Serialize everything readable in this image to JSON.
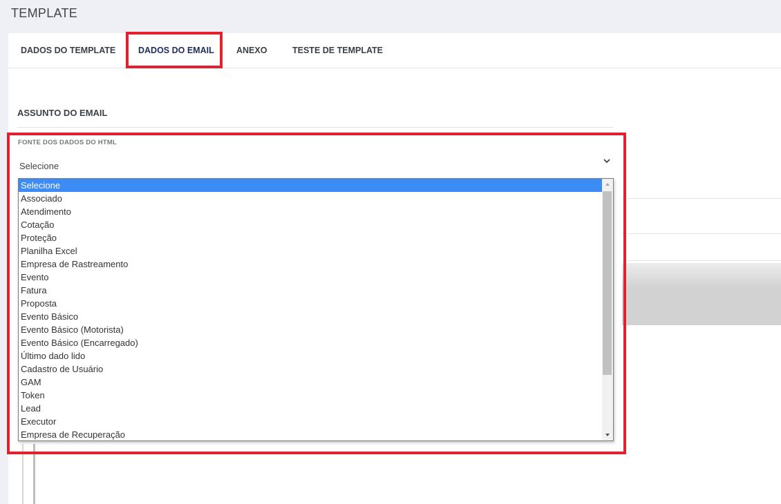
{
  "page": {
    "title": "TEMPLATE"
  },
  "tabs": [
    {
      "label": "DADOS DO TEMPLATE",
      "active": false
    },
    {
      "label": "DADOS DO EMAIL",
      "active": true
    },
    {
      "label": "ANEXO",
      "active": false
    },
    {
      "label": "TESTE DE TEMPLATE",
      "active": false
    }
  ],
  "section": {
    "title": "ASSUNTO DO EMAIL"
  },
  "field": {
    "label": "FONTE DOS DADOS DO HTML",
    "value": "Selecione",
    "options": [
      "Selecione",
      "Associado",
      "Atendimento",
      "Cotação",
      "Proteção",
      "Planilha Excel",
      "Empresa de Rastreamento",
      "Evento",
      "Fatura",
      "Proposta",
      "Evento Básico",
      "Evento Básico (Motorista)",
      "Evento Básico (Encarregado)",
      "Último dado lido",
      "Cadastro de Usuário",
      "GAM",
      "Token",
      "Lead",
      "Executor",
      "Empresa de Recuperação"
    ],
    "selected_index": 0
  },
  "colors": {
    "highlight": "#e3202d",
    "active_tab": "#1d2e5a",
    "selected_option": "#3d8bf5"
  },
  "icons": {
    "select_arrow": "chevron-down-icon"
  }
}
